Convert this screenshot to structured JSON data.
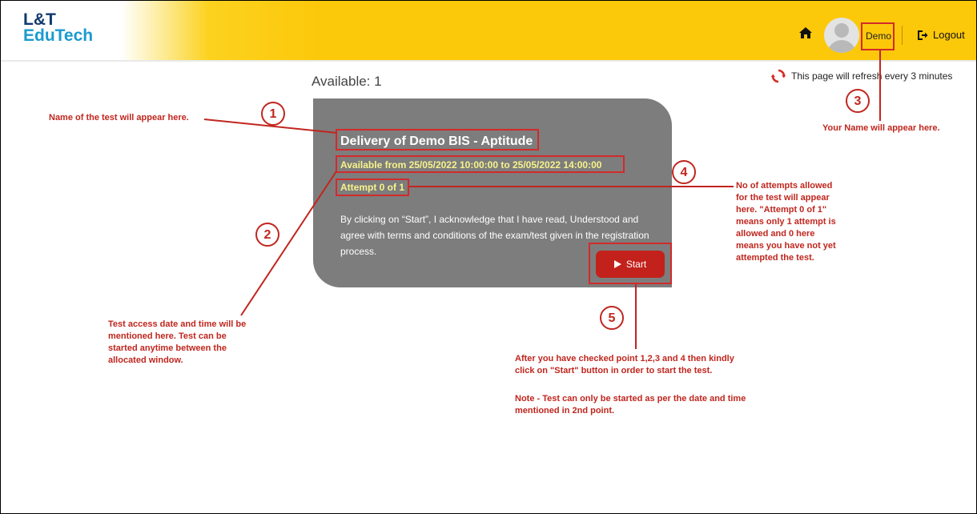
{
  "header": {
    "logo_line1": "L&T",
    "logo_line2": "EduTech",
    "username": "Demo",
    "logout_label": "Logout"
  },
  "main": {
    "available_label": "Available: 1",
    "refresh_text": "This page will refresh every 3 minutes"
  },
  "test_card": {
    "title": "Delivery of Demo BIS - Aptitude",
    "window": "Available from 25/05/2022 10:00:00 to 25/05/2022 14:00:00",
    "attempt": "Attempt 0 of 1",
    "terms": "By clicking on “Start”, I acknowledge that I have read, Understood and agree with terms and conditions of the exam/test given in the registration process.",
    "start_label": "Start"
  },
  "annotations": {
    "n1": "1",
    "n2": "2",
    "n3": "3",
    "n4": "4",
    "n5": "5",
    "note_name": "Name of the test will appear here.",
    "note_date": "Test access date and time will be mentioned here. Test can be started anytime between the allocated window.",
    "note_user": "Your Name will appear here.",
    "note_attempts": "No of attempts allowed for the test will appear here. \"Attempt 0 of 1\" means only 1 attempt is allowed and 0 here means you have not yet attempted the test.",
    "note_start": "After you have checked point 1,2,3 and 4 then kindly click on \"Start\" button in order to start the test.",
    "note_start_note": "Note - Test can only be started as per the date and time mentioned in 2nd point."
  },
  "colors": {
    "header_yellow": "#fcc80a",
    "card_gray": "#7d7d7d",
    "highlight_text": "#f7f38a",
    "start_red": "#c3211b",
    "annotation_red": "#c0261e"
  },
  "icons": [
    "home-icon",
    "avatar",
    "logout-icon",
    "refresh-icon",
    "play-icon"
  ]
}
